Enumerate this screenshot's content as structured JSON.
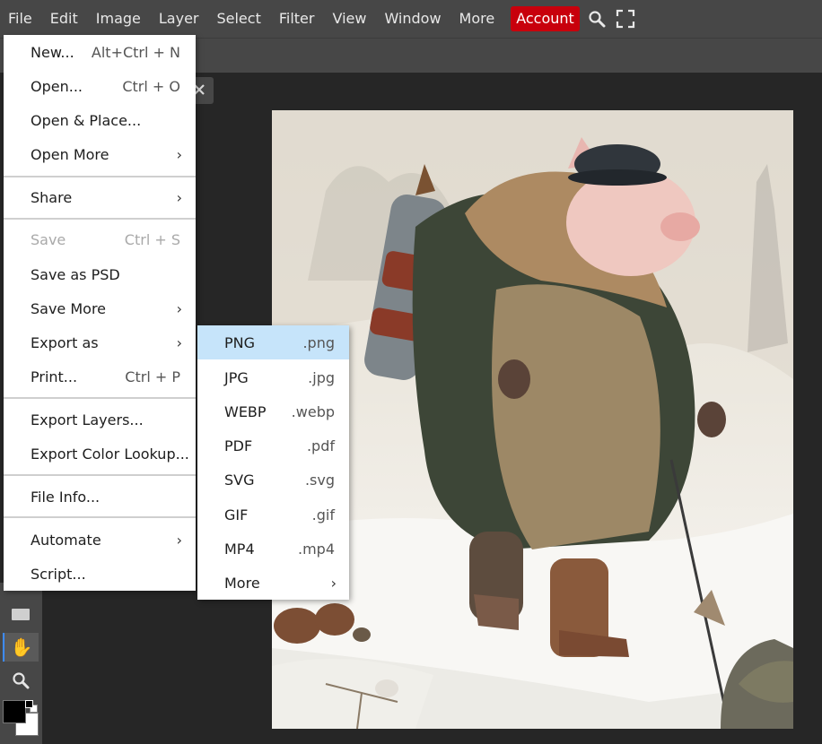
{
  "menubar": {
    "items": [
      "File",
      "Edit",
      "Image",
      "Layer",
      "Select",
      "Filter",
      "View",
      "Window",
      "More"
    ],
    "account": "Account",
    "search_icon": "search-icon",
    "fullscreen_icon": "fullscreen-icon"
  },
  "file_menu": {
    "new": {
      "label": "New...",
      "shortcut": "Alt+Ctrl + N"
    },
    "open": {
      "label": "Open...",
      "shortcut": "Ctrl + O"
    },
    "open_place": {
      "label": "Open & Place..."
    },
    "open_more": {
      "label": "Open More"
    },
    "share": {
      "label": "Share"
    },
    "save": {
      "label": "Save",
      "shortcut": "Ctrl + S"
    },
    "save_psd": {
      "label": "Save as PSD"
    },
    "save_more": {
      "label": "Save More"
    },
    "export_as": {
      "label": "Export as"
    },
    "print": {
      "label": "Print...",
      "shortcut": "Ctrl + P"
    },
    "export_layers": {
      "label": "Export Layers..."
    },
    "export_lookup": {
      "label": "Export Color Lookup..."
    },
    "file_info": {
      "label": "File Info..."
    },
    "automate": {
      "label": "Automate"
    },
    "script": {
      "label": "Script..."
    }
  },
  "export_menu": {
    "png": {
      "label": "PNG",
      "ext": ".png"
    },
    "jpg": {
      "label": "JPG",
      "ext": ".jpg"
    },
    "webp": {
      "label": "WEBP",
      "ext": ".webp"
    },
    "pdf": {
      "label": "PDF",
      "ext": ".pdf"
    },
    "svg": {
      "label": "SVG",
      "ext": ".svg"
    },
    "gif": {
      "label": "GIF",
      "ext": ".gif"
    },
    "mp4": {
      "label": "MP4",
      "ext": ".mp4"
    },
    "more": {
      "label": "More"
    }
  },
  "arrow_glyph": "›",
  "colors": {
    "account_bg": "#c8000c",
    "highlight": "#c6e4fa",
    "active_tool": "#3d8bff",
    "foreground_swatch": "#000000",
    "background_swatch": "#ffffff"
  }
}
